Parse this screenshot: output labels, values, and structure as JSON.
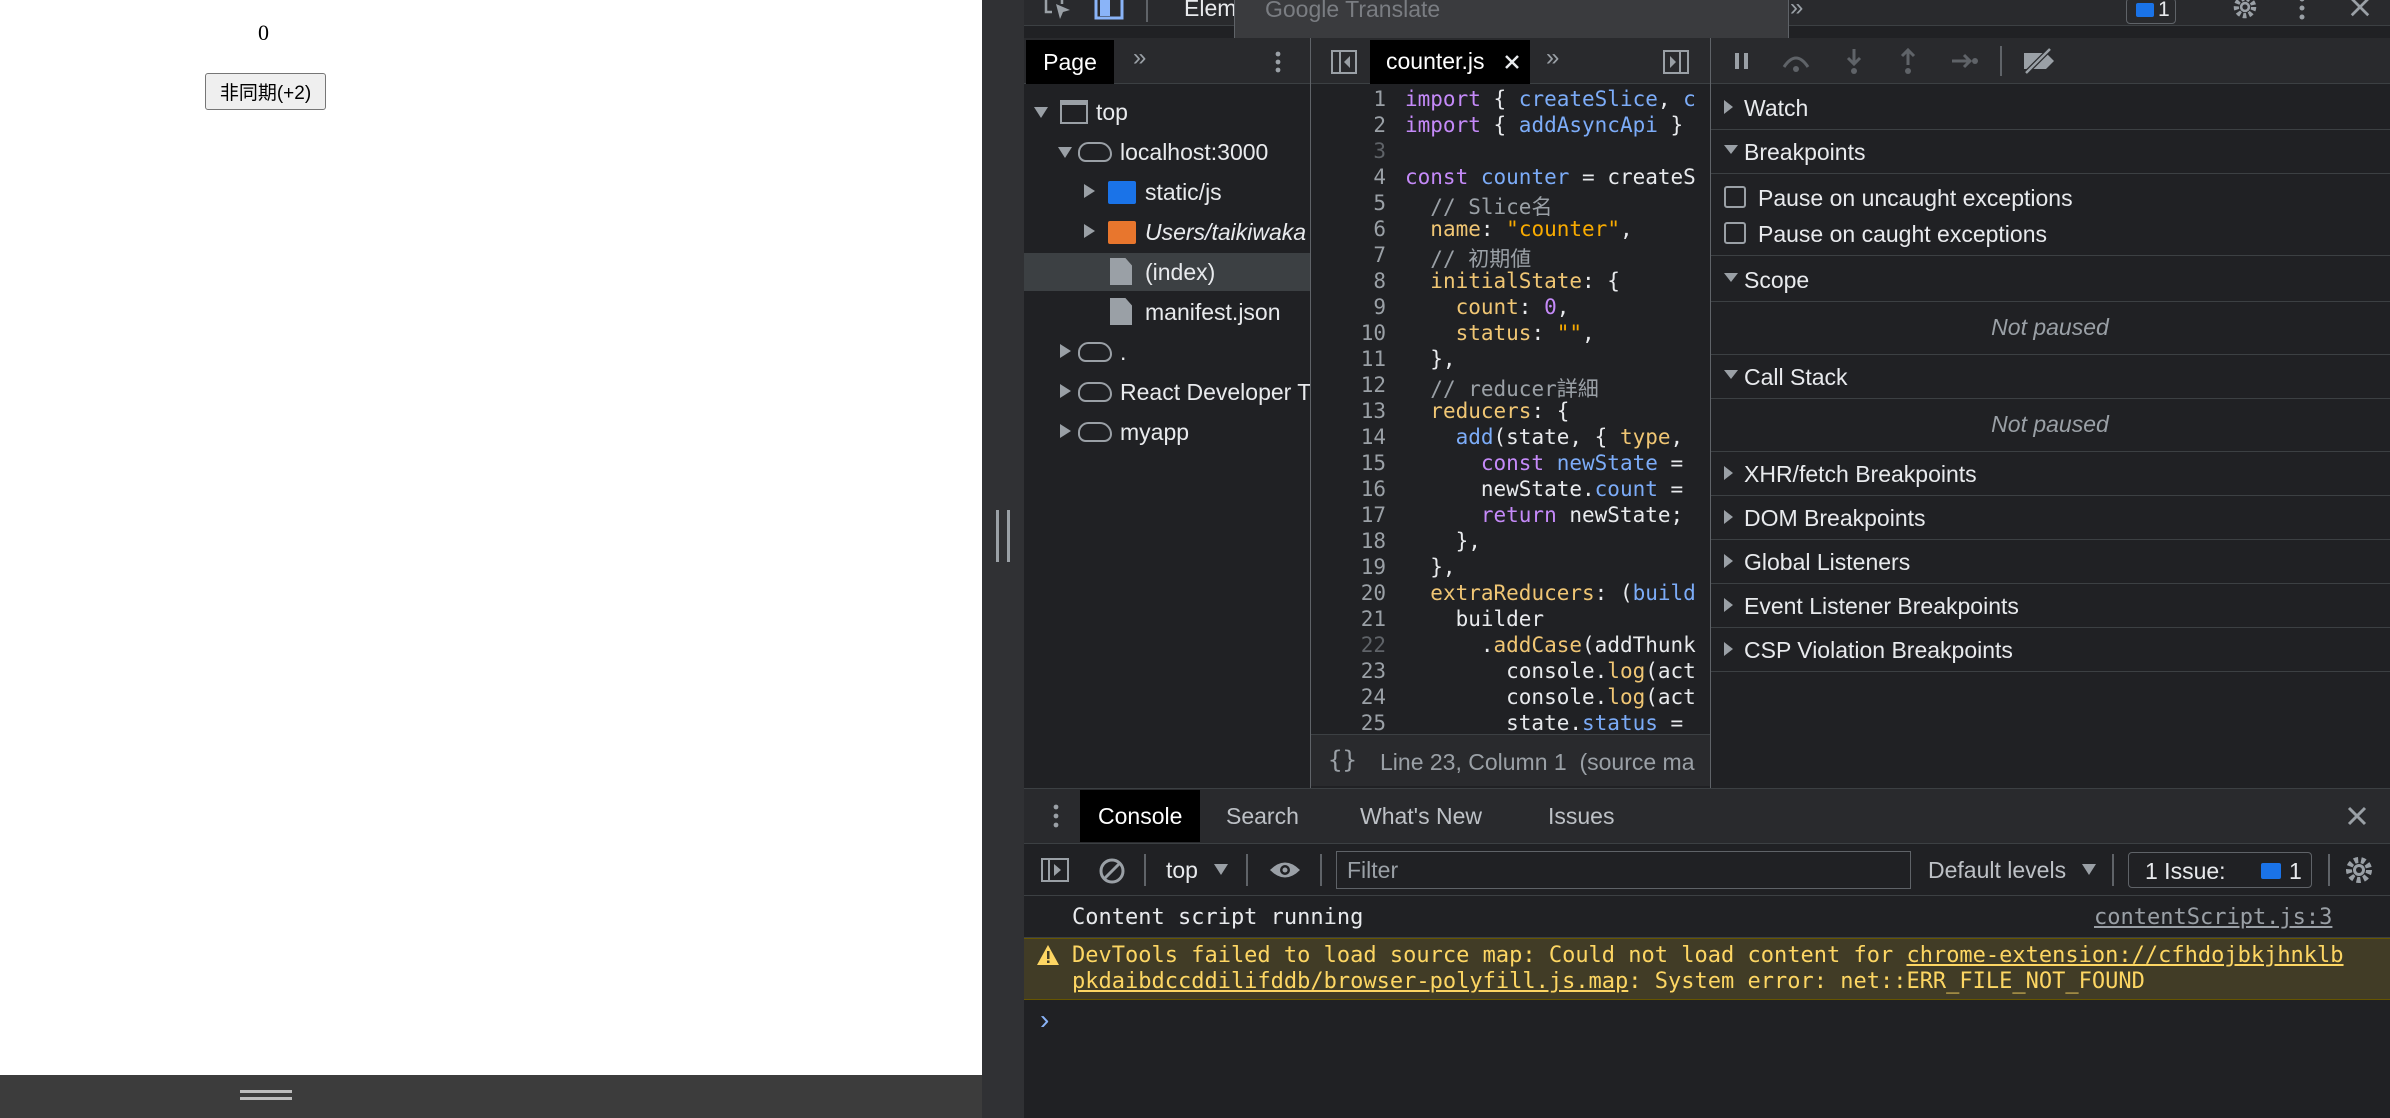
{
  "page": {
    "counter_value": "0",
    "async_button_label": "非同期(+2)"
  },
  "devtools": {
    "main_tabs": {
      "elements_partial": "Elem",
      "more": "»"
    },
    "translate_popup": "Google Translate",
    "issues_badge_count": "1",
    "navigator": {
      "tab_label": "Page",
      "more": "»",
      "tree": [
        {
          "label": "top"
        },
        {
          "label": "localhost:3000"
        },
        {
          "label": "static/js"
        },
        {
          "label": "Users/taikiwaka"
        },
        {
          "label": "(index)"
        },
        {
          "label": "manifest.json"
        },
        {
          "label": "."
        },
        {
          "label": "React Developer T"
        },
        {
          "label": "myapp"
        }
      ]
    },
    "editor": {
      "file_tab": "counter.js",
      "more": "»",
      "status": "Line 23, Column 1  (source ma",
      "pretty_print": "{}",
      "line_numbers": [
        "1",
        "2",
        "3",
        "4",
        "5",
        "6",
        "7",
        "8",
        "9",
        "10",
        "11",
        "12",
        "13",
        "14",
        "15",
        "16",
        "17",
        "18",
        "19",
        "20",
        "21",
        "22",
        "23",
        "24",
        "25"
      ]
    },
    "debugger": {
      "watch": "Watch",
      "breakpoints": "Breakpoints",
      "pause_uncaught": "Pause on uncaught exceptions",
      "pause_caught": "Pause on caught exceptions",
      "scope": "Scope",
      "scope_state": "Not paused",
      "call_stack": "Call Stack",
      "call_stack_state": "Not paused",
      "xhr": "XHR/fetch Breakpoints",
      "dom": "DOM Breakpoints",
      "global": "Global Listeners",
      "event": "Event Listener Breakpoints",
      "csp": "CSP Violation Breakpoints"
    },
    "drawer": {
      "tabs": [
        "Console",
        "Search",
        "What's New",
        "Issues"
      ],
      "context": "top",
      "filter_placeholder": "Filter",
      "levels": "Default levels",
      "issues_label": "1 Issue:",
      "issues_count": "1"
    },
    "console": {
      "msg1_text": "Content script running",
      "msg1_source": "contentScript.js:3",
      "warn_prefix": "DevTools failed to load source map: Could not load content for ",
      "warn_link1": "chrome-extension://cfhdojbkjhnklb",
      "warn_link2": "pkdaibdccddilifddb/browser-polyfill.js.map",
      "warn_suffix": ": System error: net::ERR_FILE_NOT_FOUND",
      "prompt": "›"
    }
  },
  "colors": {
    "devtools_bg": "#202124",
    "selected_tab_bg": "#000000",
    "keyword": "#c58af9",
    "function": "#7cacf8",
    "string": "#f28b82",
    "warning_bg": "#413c26",
    "warning_text": "#fdd663",
    "folder_blue": "#1a73e8",
    "folder_orange": "#e8762d",
    "badge_blue": "#1a73e8"
  }
}
